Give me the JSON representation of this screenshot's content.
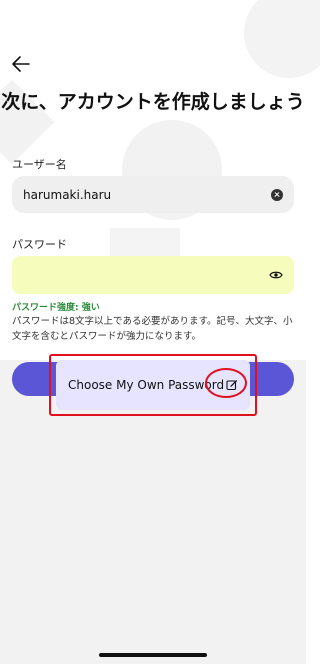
{
  "header": {
    "title": "次に、アカウントを作成しましょう"
  },
  "username": {
    "label": "ユーザー名",
    "value": "harumaki.haru"
  },
  "password": {
    "label": "パスワード",
    "strength": "パスワード強度: 強い",
    "hint": "パスワードは8文字以上である必要があります。記号、大文字、小文字を含むとパスワードが強力になります。"
  },
  "suggestion": {
    "label": "Choose My Own Password"
  },
  "colors": {
    "accent": "#5a56d6",
    "password_bg": "#f6fcbc",
    "strength": "#2c8a3a",
    "highlight": "#e0101e"
  },
  "icons": [
    "back-arrow-icon",
    "clear-icon",
    "eye-icon",
    "edit-icon"
  ]
}
